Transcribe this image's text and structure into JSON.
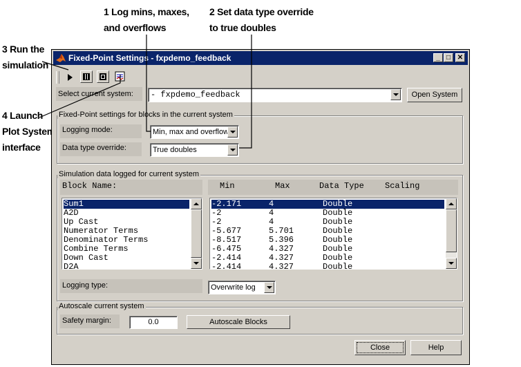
{
  "callouts": {
    "c1": [
      "1 Log mins, maxes,",
      "and overflows"
    ],
    "c2": [
      "2 Set data type override",
      "to true doubles"
    ],
    "c3": [
      "3 Run the",
      "simulation"
    ],
    "c4": [
      "4 Launch",
      "Plot System",
      "interface"
    ]
  },
  "window": {
    "title": "Fixed-Point Settings - fxpdemo_feedback",
    "minimize": "_",
    "maximize": "□",
    "close": "✕"
  },
  "toolbar": {
    "icons": [
      "play-icon",
      "pause-icon",
      "stop-icon",
      "plot-system-icon"
    ]
  },
  "system": {
    "label": "Select current system:",
    "value": "- fxpdemo_feedback",
    "open_button": "Open System"
  },
  "fxp_group": {
    "title": "Fixed-Point settings for blocks in the current system",
    "logging_mode_label": "Logging mode:",
    "logging_mode_value": "Min, max and overflow",
    "dto_label": "Data type override:",
    "dto_value": "True doubles"
  },
  "sim_group": {
    "title": "Simulation data logged for current system",
    "block_header": "Block Name:",
    "columns": [
      "Min",
      "Max",
      "Data Type",
      "Scaling"
    ],
    "blocks": [
      "Sum1",
      "A2D",
      "Up Cast",
      "Numerator Terms",
      "Denominator Terms",
      "Combine Terms",
      "Down Cast",
      "D2A"
    ],
    "rows": [
      {
        "min": "-2.171",
        "max": "4",
        "type": "Double",
        "scaling": ""
      },
      {
        "min": "-2",
        "max": "4",
        "type": "Double",
        "scaling": ""
      },
      {
        "min": "-2",
        "max": "4",
        "type": "Double",
        "scaling": ""
      },
      {
        "min": "-5.677",
        "max": "5.701",
        "type": "Double",
        "scaling": ""
      },
      {
        "min": "-8.517",
        "max": "5.396",
        "type": "Double",
        "scaling": ""
      },
      {
        "min": "-6.475",
        "max": "4.327",
        "type": "Double",
        "scaling": ""
      },
      {
        "min": "-2.414",
        "max": "4.327",
        "type": "Double",
        "scaling": ""
      },
      {
        "min": "-2.414",
        "max": "4.327",
        "type": "Double",
        "scaling": ""
      }
    ],
    "selected_index": 0,
    "logging_type_label": "Logging type:",
    "logging_type_value": "Overwrite log"
  },
  "autoscale_group": {
    "title": "Autoscale current system",
    "safety_label": "Safety margin:",
    "safety_value": "0.0",
    "autoscale_button": "Autoscale Blocks"
  },
  "footer": {
    "close_button": "Close",
    "help_button": "Help"
  },
  "colors": {
    "selection": "#0a246a",
    "window_bg": "#d4d0c8"
  }
}
